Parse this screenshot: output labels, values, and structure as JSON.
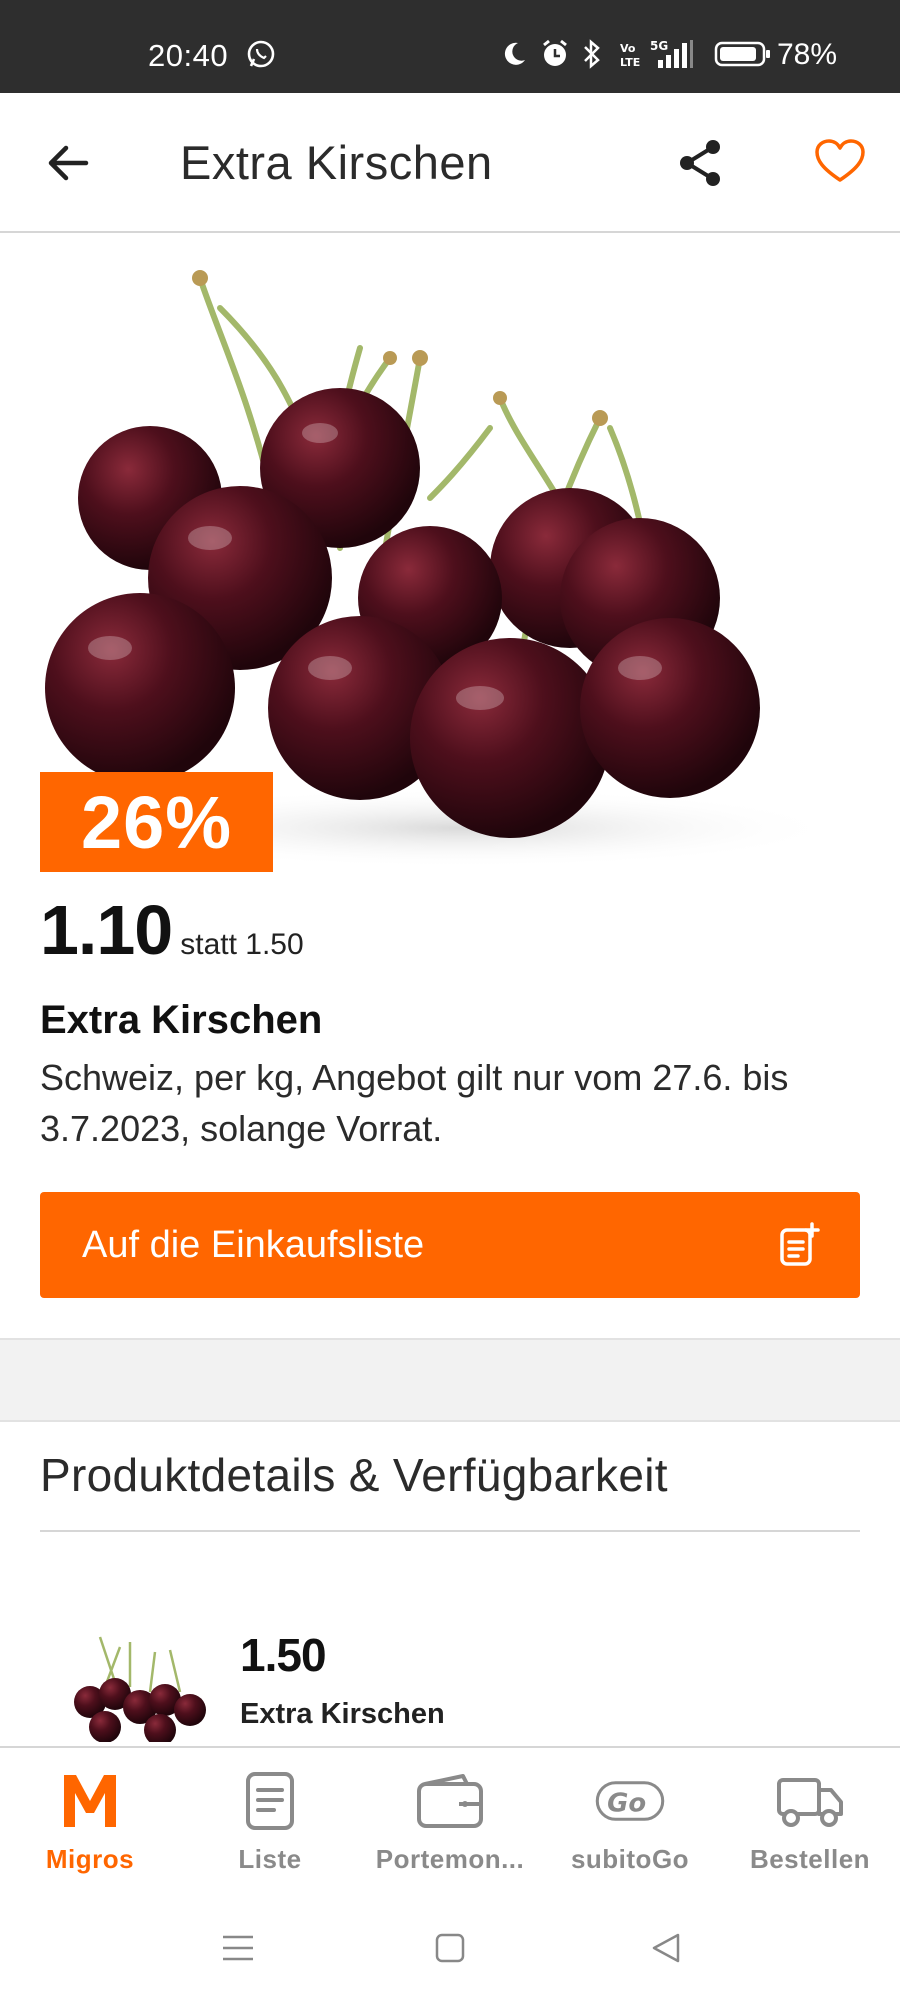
{
  "status_bar": {
    "time": "20:40",
    "icons": [
      "whatsapp-icon",
      "do-not-disturb-icon",
      "alarm-icon",
      "bluetooth-icon",
      "volte-icon",
      "signal-5g-icon",
      "battery-icon"
    ],
    "battery_percent": "78%"
  },
  "app_bar": {
    "title": "Extra Kirschen",
    "back_icon": "arrow-left-icon",
    "share_icon": "share-icon",
    "favorite_icon": "heart-outline-icon"
  },
  "product": {
    "image": "cherries-photo",
    "discount_badge": "26%",
    "price": "1.10",
    "old_price_text": "statt 1.50",
    "name": "Extra Kirschen",
    "description": "Schweiz, per kg, Angebot gilt nur vom 27.6. bis 3.7.2023, solange Vorrat."
  },
  "cta": {
    "label": "Auf die Einkaufsliste",
    "icon": "add-to-list-icon"
  },
  "details": {
    "section_title": "Produktdetails & Verfügbarkeit",
    "item": {
      "price": "1.50",
      "name": "Extra Kirschen"
    }
  },
  "bottom_nav": {
    "items": [
      {
        "label": "Migros",
        "icon": "migros-m-icon",
        "active": true
      },
      {
        "label": "Liste",
        "icon": "list-icon",
        "active": false
      },
      {
        "label": "Portemon...",
        "icon": "wallet-icon",
        "active": false
      },
      {
        "label": "subitoGo",
        "icon": "subitogo-icon",
        "active": false
      },
      {
        "label": "Bestellen",
        "icon": "truck-icon",
        "active": false
      }
    ]
  },
  "colors": {
    "accent": "#ff6600",
    "status_bar": "#2e2e2e",
    "text": "#1e1e1e",
    "nav_inactive": "#8a8a8a"
  }
}
